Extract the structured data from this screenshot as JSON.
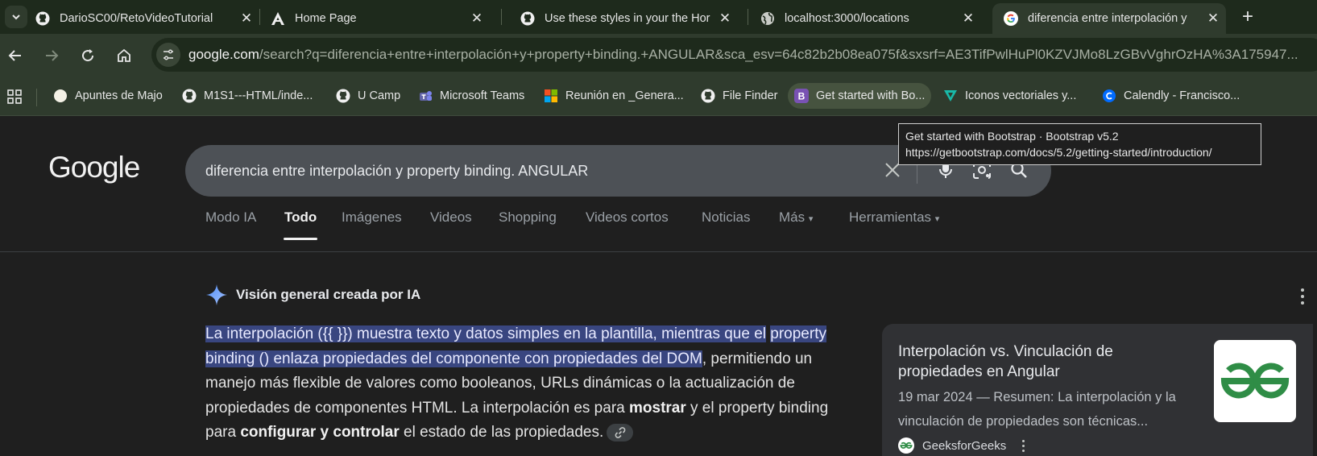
{
  "browser": {
    "tabs": [
      {
        "title": "DarioSC00/RetoVideoTutorial",
        "icon": "github-icon"
      },
      {
        "title": "Home Page",
        "icon": "angular-icon"
      },
      {
        "title": "Use these styles in your the Hor",
        "icon": "github-icon"
      },
      {
        "title": "localhost:3000/locations",
        "icon": "globe-icon"
      },
      {
        "title": "diferencia entre interpolación y",
        "icon": "google-icon",
        "active": true
      }
    ],
    "close_glyph": "✕",
    "new_tab_glyph": "+",
    "url_host": "google.com",
    "url_path": "/search?q=diferencia+entre+interpolación+y+property+binding.+ANGULAR&sca_esv=64c82b2b08ea075f&sxsrf=AE3TifPwlHuPl0KZVJMo8LzGBvVghrOzHA%3A175947...",
    "bookmarks": [
      {
        "label": "Apuntes de Majo",
        "icon": "circle-icon"
      },
      {
        "label": "M1S1---HTML/inde...",
        "icon": "github-icon"
      },
      {
        "label": "U Camp",
        "icon": "github-icon"
      },
      {
        "label": "Microsoft Teams",
        "icon": "teams-icon"
      },
      {
        "label": "Reunión en _Genera...",
        "icon": "microsoft-icon"
      },
      {
        "label": "File Finder",
        "icon": "github-icon"
      },
      {
        "label": "Get started with Bo...",
        "icon": "bootstrap-icon",
        "hover": true
      },
      {
        "label": "Iconos vectoriales y...",
        "icon": "vector-icon"
      },
      {
        "label": "Calendly - Francisco...",
        "icon": "calendly-icon"
      }
    ],
    "tooltip": {
      "line1": "Get started with Bootstrap · Bootstrap v5.2",
      "line2": "https://getbootstrap.com/docs/5.2/getting-started/introduction/"
    }
  },
  "google": {
    "logo": "Google",
    "query": "diferencia entre interpolación y property binding. ANGULAR",
    "tabs": [
      "Modo IA",
      "Todo",
      "Imágenes",
      "Videos",
      "Shopping",
      "Videos cortos",
      "Noticias",
      "Más",
      "Herramientas"
    ],
    "active_tab": "Todo",
    "ai_overview": {
      "title": "Visión general creada por IA",
      "highlight_1": "La interpolación ({{ }}) muestra texto y datos simples en la plantilla, mientras que el",
      "highlight_2": "property binding () enlaza propiedades del componente con propiedades del DOM",
      "text_after_highlight": ", permitiendo un manejo más flexible de valores como booleanos, URLs dinámicas o la actualización de propiedades de componentes HTML. La interpolación es para ",
      "bold_1": "mostrar",
      "text_mid": " y el property binding para ",
      "bold_2": "configurar y controlar",
      "text_end": " el estado de las propiedades."
    },
    "source_card": {
      "title": "Interpolación vs. Vinculación de propiedades en Angular",
      "snippet": "19 mar 2024 — Resumen: La interpolación y la vinculación de propiedades son técnicas...",
      "source": "GeeksforGeeks"
    }
  },
  "colors": {
    "frame": "#1e2a1c",
    "toolbar": "#2f3b2d",
    "page_bg": "#1f1f1f",
    "highlight": "#394680",
    "gfg_green": "#2f8d46"
  }
}
